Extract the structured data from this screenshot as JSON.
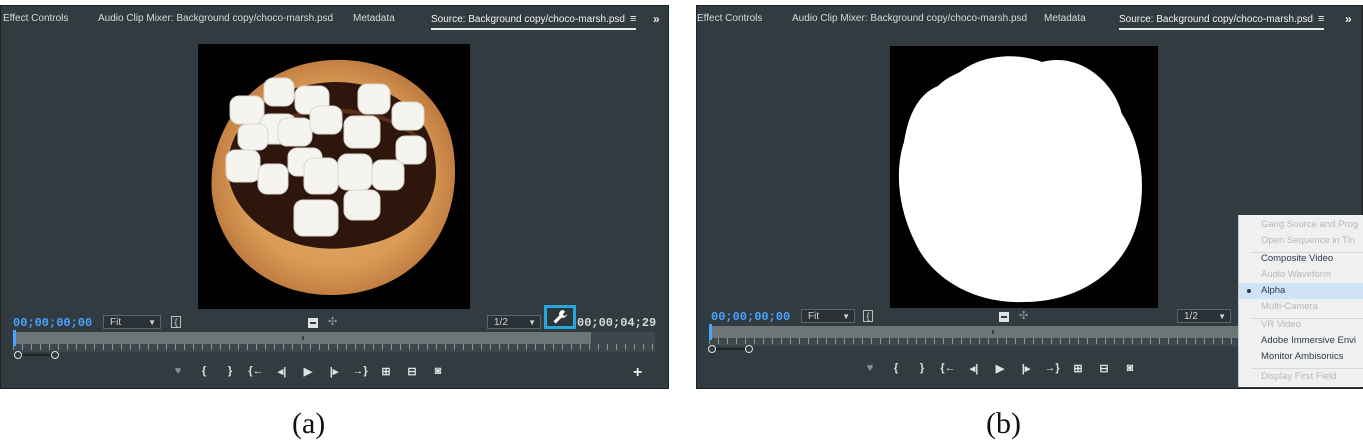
{
  "panel_a": {
    "tabs": [
      "Effect Controls",
      "Audio Clip Mixer: Background copy/choco-marsh.psd",
      "Metadata",
      "Source: Background copy/choco-marsh.psd"
    ],
    "menu_glyph": "≡",
    "overflow": "»",
    "timecode_start": "00;00;00;00",
    "fit_label": "Fit",
    "resolution": "1/2",
    "timecode_end": "00;00;04;29"
  },
  "panel_b": {
    "tabs": [
      "Effect Controls",
      "Audio Clip Mixer: Background copy/choco-marsh.psd",
      "Metadata",
      "Source: Background copy/choco-marsh.psd"
    ],
    "menu_glyph": "≡",
    "overflow": "»",
    "timecode_start": "00;00;00;00",
    "fit_label": "Fit",
    "resolution": "1/2"
  },
  "context_menu": {
    "items": [
      {
        "label": "Gang Source and Prog",
        "enabled": false
      },
      {
        "label": "Open Sequence in Tin",
        "enabled": false
      },
      {
        "label": "Composite Video",
        "enabled": true
      },
      {
        "label": "Audio Waveform",
        "enabled": false
      },
      {
        "label": "Alpha",
        "enabled": true,
        "checked": true
      },
      {
        "label": "Multi-Camera",
        "enabled": false
      },
      {
        "label": "VR Video",
        "enabled": false
      },
      {
        "label": "Adobe Immersive Envi",
        "enabled": true
      },
      {
        "label": "Monitor Ambisonics",
        "enabled": true
      },
      {
        "label": "Display First Field",
        "enabled": false
      }
    ]
  },
  "captions": {
    "a": "(a)",
    "b": "(b)"
  },
  "colors": {
    "panel_bg": "#323b40",
    "accent_blue": "#4aa3ff",
    "highlight_border": "#2ba6d8",
    "menu_bg": "#f0f0f0",
    "menu_selected": "#cfe2f6"
  },
  "icons": {
    "transport": [
      "marker-icon",
      "mark-in-icon",
      "mark-out-icon",
      "go-to-in-icon",
      "step-back-icon",
      "play-icon",
      "step-forward-icon",
      "go-to-out-icon",
      "insert-icon",
      "overwrite-icon",
      "export-frame-icon"
    ],
    "settings": "wrench-icon",
    "add": "plus-icon"
  }
}
